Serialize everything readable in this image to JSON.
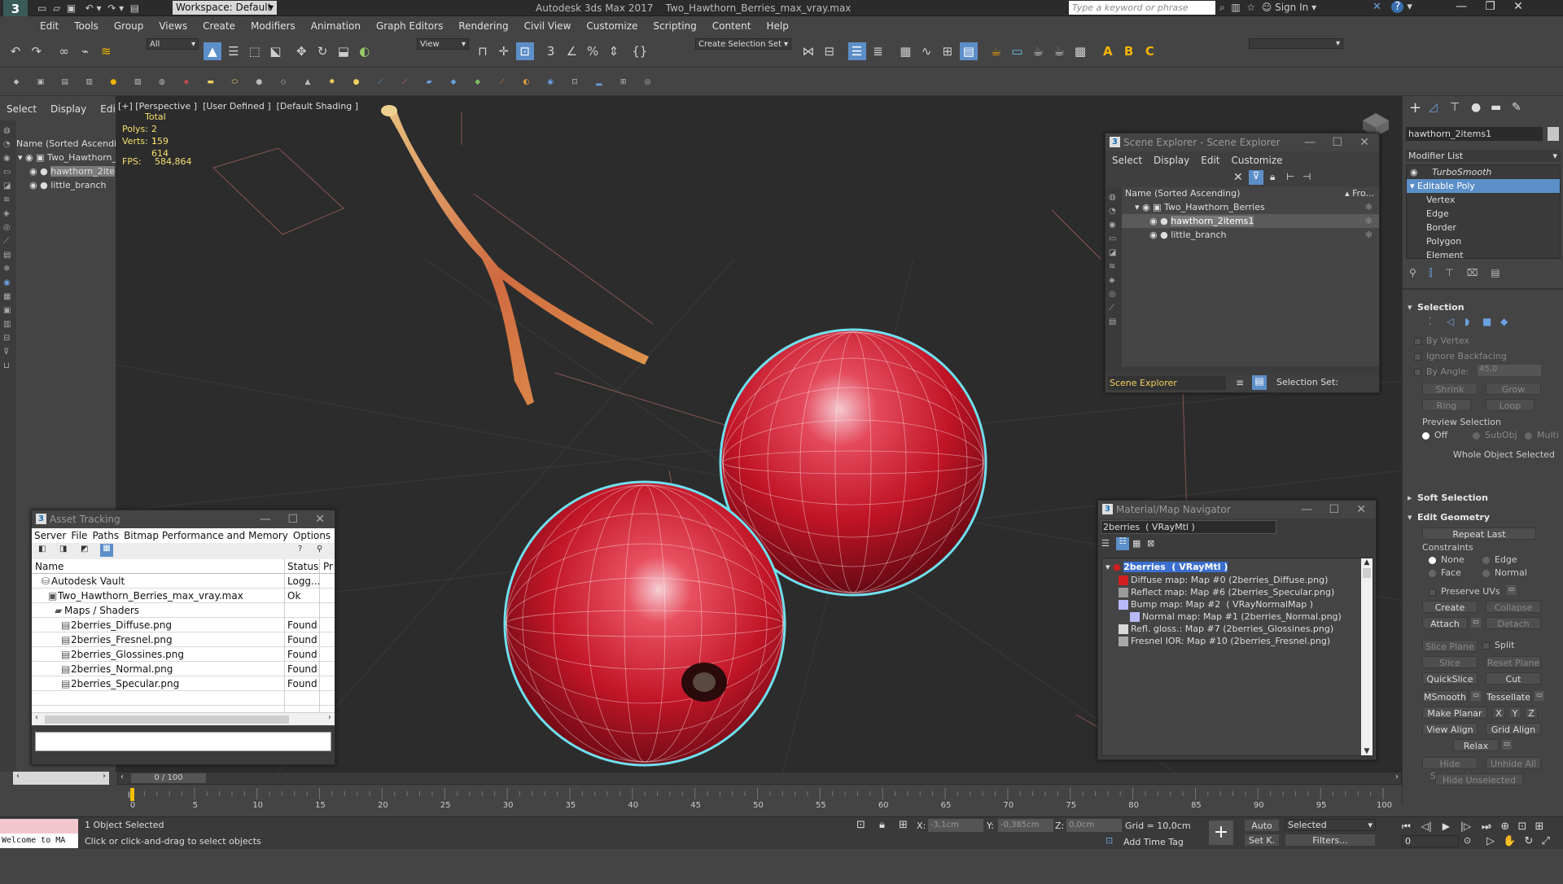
{
  "titlebar": {
    "workspace": "Workspace: Default",
    "title": "Autodesk 3ds Max 2017    Two_Hawthorn_Berries_max_vray.max",
    "search_placeholder": "Type a keyword or phrase",
    "sign_in": "Sign In"
  },
  "menu": [
    "Edit",
    "Tools",
    "Group",
    "Views",
    "Create",
    "Modifiers",
    "Animation",
    "Graph Editors",
    "Rendering",
    "Civil View",
    "Customize",
    "Scripting",
    "Content",
    "Help"
  ],
  "toolbar": {
    "filter": "All",
    "view": "View",
    "create_selection_set": "Create Selection Set"
  },
  "left_panel": {
    "menu": [
      "Select",
      "Display",
      "Edit"
    ],
    "header": "Name (Sorted Ascending)",
    "items": [
      "Two_Hawthorn_",
      "hawthorn_2ite",
      "little_branch"
    ]
  },
  "viewport": {
    "label": "[+] [Perspective ]  [User Defined ]  [Default Shading ]",
    "stats_total": "Total",
    "polys_label": "Polys:",
    "polys_value": "2 159",
    "verts_label": "Verts:",
    "verts_value": "1 614",
    "fps_label": "FPS:",
    "fps_value": "584,864"
  },
  "scene_explorer": {
    "title": "Scene Explorer - Scene Explorer",
    "menu": [
      "Select",
      "Display",
      "Edit",
      "Customize"
    ],
    "col_name": "Name (Sorted Ascending)",
    "col_frozen": "▴ Fro...",
    "items": [
      {
        "name": "Two_Hawthorn_Berries",
        "level": 0
      },
      {
        "name": "hawthorn_2items1",
        "level": 1,
        "selected": true
      },
      {
        "name": "little_branch",
        "level": 1
      }
    ],
    "footer_name": "Scene Explorer",
    "footer_sel": "Selection Set:"
  },
  "asset_tracking": {
    "title": "Asset Tracking",
    "menu": [
      "Server",
      "File",
      "Paths",
      "Bitmap Performance and Memory",
      "Options"
    ],
    "cols": [
      "Name",
      "Status",
      "Pr"
    ],
    "rows": [
      {
        "name": "Autodesk Vault",
        "status": "Logg...",
        "indent": 1
      },
      {
        "name": "Two_Hawthorn_Berries_max_vray.max",
        "status": "Ok",
        "indent": 2
      },
      {
        "name": "Maps / Shaders",
        "status": "",
        "indent": 3
      },
      {
        "name": "2berries_Diffuse.png",
        "status": "Found",
        "indent": 4
      },
      {
        "name": "2berries_Fresnel.png",
        "status": "Found",
        "indent": 4
      },
      {
        "name": "2berries_Glossines.png",
        "status": "Found",
        "indent": 4
      },
      {
        "name": "2berries_Normal.png",
        "status": "Found",
        "indent": 4
      },
      {
        "name": "2berries_Specular.png",
        "status": "Found",
        "indent": 4
      }
    ]
  },
  "material_nav": {
    "title": "Material/Map Navigator",
    "field": "2berries  ( VRayMtl )",
    "root": "2berries  ( VRayMtl )",
    "items": [
      "Diffuse map: Map #0 (2berries_Diffuse.png)",
      "Reflect map: Map #6 (2berries_Specular.png)",
      "Bump map: Map #2  ( VRayNormalMap )",
      "Normal map: Map #1 (2berries_Normal.png)",
      "Refl. gloss.: Map #7 (2berries_Glossines.png)",
      "Fresnel IOR: Map #10 (2berries_Fresnel.png)"
    ]
  },
  "command_panel": {
    "object_name": "hawthorn_2items1",
    "modifier_list": "Modifier List",
    "stack": [
      "TurboSmooth",
      "Editable Poly",
      "Vertex",
      "Edge",
      "Border",
      "Polygon",
      "Element"
    ],
    "selection": {
      "title": "Selection",
      "by_vertex": "By Vertex",
      "ignore_backfacing": "Ignore Backfacing",
      "by_angle": "By Angle:",
      "angle_value": "45,0",
      "shrink": "Shrink",
      "grow": "Grow",
      "ring": "Ring",
      "loop": "Loop",
      "preview": "Preview Selection",
      "off": "Off",
      "subobj": "SubObj",
      "multi": "Multi",
      "status": "Whole Object Selected"
    },
    "soft_selection": "Soft Selection",
    "edit_geometry": {
      "title": "Edit Geometry",
      "repeat_last": "Repeat Last",
      "constraints": "Constraints",
      "none": "None",
      "edge": "Edge",
      "face": "Face",
      "normal": "Normal",
      "preserve_uvs": "Preserve UVs",
      "create": "Create",
      "collapse": "Collapse",
      "attach": "Attach",
      "detach": "Detach",
      "slice_plane": "Slice Plane",
      "split": "Split",
      "slice": "Slice",
      "reset_plane": "Reset Plane",
      "quickslice": "QuickSlice",
      "cut": "Cut",
      "msmooth": "MSmooth",
      "tessellate": "Tessellate",
      "make_planar": "Make Planar",
      "x": "X",
      "y": "Y",
      "z": "Z",
      "view_align": "View Align",
      "grid_align": "Grid Align",
      "relax": "Relax",
      "hide_selected": "Hide Selected",
      "unhide_all": "Unhide All",
      "hide_unselected": "Hide Unselected"
    }
  },
  "timeline": {
    "frame": "0 / 100",
    "ticks": [
      "0",
      "5",
      "10",
      "15",
      "20",
      "25",
      "30",
      "35",
      "40",
      "45",
      "50",
      "55",
      "60",
      "65",
      "70",
      "75",
      "80",
      "85",
      "90",
      "95",
      "100"
    ]
  },
  "status": {
    "welcome": "Welcome to MA",
    "objects": "1 Object Selected",
    "hint": "Click or click-and-drag to select objects",
    "x_label": "X:",
    "x_value": "-3,1cm",
    "y_label": "Y:",
    "y_value": "-0,385cm",
    "z_label": "Z:",
    "z_value": "0,0cm",
    "grid": "Grid = 10,0cm",
    "add_time_tag": "Add Time Tag",
    "auto": "Auto",
    "setk": "Set K.",
    "selected": "Selected",
    "filters": "Filters...",
    "frame_value": "0"
  }
}
